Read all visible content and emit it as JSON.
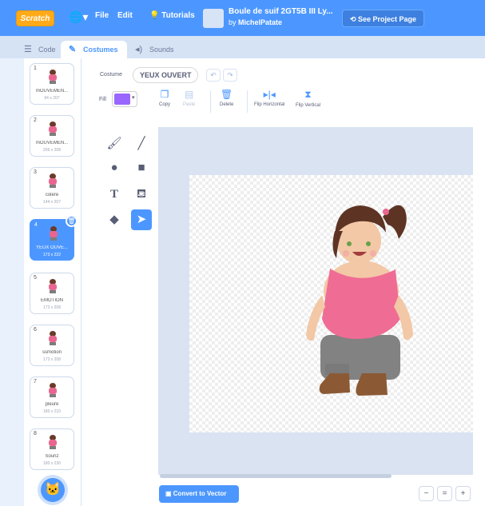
{
  "menu": {
    "logo": "Scratch",
    "file": "File",
    "edit": "Edit",
    "tutorials": "Tutorials",
    "project_title": "Boule de suif 2GT5B III Ly...",
    "by_prefix": "by",
    "author": "MichelPatate",
    "see_project": "See Project Page"
  },
  "tabs": [
    {
      "label": "Code",
      "icon": "code-icon"
    },
    {
      "label": "Costumes",
      "icon": "brush-icon"
    },
    {
      "label": "Sounds",
      "icon": "speaker-icon"
    }
  ],
  "costumes": [
    {
      "num": "1",
      "name": "mOUVEMEN...",
      "size": "94 x 207"
    },
    {
      "num": "2",
      "name": "mOUVEMEN...",
      "size": "206 x 208"
    },
    {
      "num": "3",
      "name": "colere",
      "size": "144 x 207"
    },
    {
      "num": "4",
      "name": "YEUX OUVE...",
      "size": "173 x 222"
    },
    {
      "num": "5",
      "name": "EMOTION",
      "size": "173 x 208"
    },
    {
      "num": "6",
      "name": "ssmotion",
      "size": "173 x 208"
    },
    {
      "num": "7",
      "name": "pleure",
      "size": "180 x 210"
    },
    {
      "num": "8",
      "name": "Souriz",
      "size": "180 x 230"
    }
  ],
  "selected_costume_index": 3,
  "editor": {
    "costume_label": "Costume",
    "costume_name": "YEUX OUVERT",
    "fill_label": "Fill",
    "fill_color": "#9966ff",
    "copy": "Copy",
    "paste": "Paste",
    "delete": "Delete",
    "flip_h": "Flip Horizontal",
    "flip_v": "Flip Vertical",
    "convert": "Convert to Vector",
    "zoom_out": "−",
    "zoom_reset": "=",
    "zoom_in": "+"
  },
  "colors": {
    "accent": "#4c97ff",
    "menu": "#4c97ff",
    "logo": "#ffab19"
  }
}
